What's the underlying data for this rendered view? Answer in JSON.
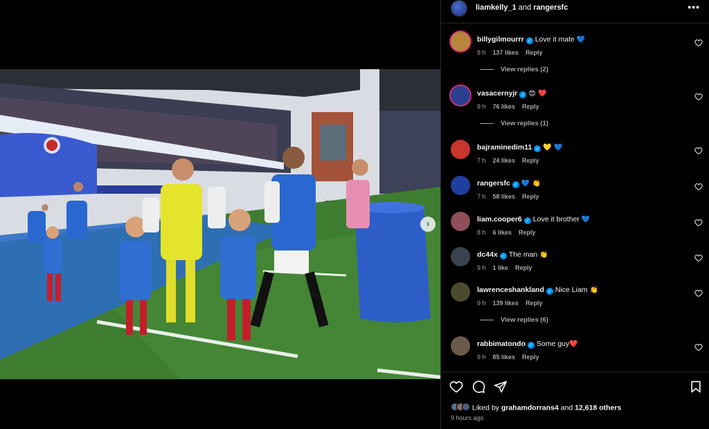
{
  "post": {
    "author": "liamkelly_1",
    "connector": "and",
    "collaborator": "rangersfc",
    "more_label": "•••"
  },
  "icons": {
    "verified": "verified-badge-icon",
    "heart": "heart-icon",
    "comment": "comment-icon",
    "share": "paper-plane-icon",
    "save": "bookmark-icon",
    "next": "chevron-right-icon"
  },
  "comments": [
    {
      "user": "billygilmourrr",
      "text": "Love it mate",
      "emoji": "💙",
      "time": "9 h",
      "likes": "137 likes",
      "reply": "Reply",
      "avatar_color": "#b8863b",
      "ring": true
    },
    {
      "user": "vasacernyjr",
      "text": "",
      "emoji": "😍 ❤️",
      "time": "9 h",
      "likes": "76 likes",
      "reply": "Reply",
      "avatar_color": "#2b3f8f",
      "ring": true
    },
    {
      "user": "bajraminedim11",
      "text": "",
      "emoji": "💛 💙",
      "time": "7 h",
      "likes": "24 likes",
      "reply": "Reply",
      "avatar_color": "#c8362d",
      "ring": false
    },
    {
      "user": "rangersfc",
      "text": "",
      "emoji": "💙 👏",
      "time": "7 h",
      "likes": "58 likes",
      "reply": "Reply",
      "avatar_color": "#1f3f9e",
      "ring": false
    },
    {
      "user": "liam.cooper6",
      "text": "Love it brother",
      "emoji": "💙",
      "time": "8 h",
      "likes": "6 likes",
      "reply": "Reply",
      "avatar_color": "#8e4f5a",
      "ring": false
    },
    {
      "user": "dc44x",
      "text": "The man",
      "emoji": "👏",
      "time": "9 h",
      "likes": "1 like",
      "reply": "Reply",
      "avatar_color": "#39434f",
      "ring": false
    },
    {
      "user": "lawrenceshankland",
      "text": "Nice Liam",
      "emoji": "👏",
      "time": "9 h",
      "likes": "139 likes",
      "reply": "Reply",
      "avatar_color": "#4a4a2c",
      "ring": false
    },
    {
      "user": "rabbimatondo",
      "text": "Some guy",
      "emoji": "❤️",
      "time": "9 h",
      "likes": "85 likes",
      "reply": "Reply",
      "avatar_color": "#6b5a4a",
      "ring": false
    }
  ],
  "view_replies": [
    "View replies (2)",
    "View replies (1)",
    "View replies (6)"
  ],
  "footer": {
    "liked_prefix": "Liked by",
    "liked_user": "grahamdorrans4",
    "liked_and": "and",
    "liked_others": "12,618 others",
    "time_ago": "9 hours ago"
  },
  "colors": {
    "background": "#000000",
    "verified": "#0095f6",
    "muted": "#a8a8a8",
    "rangers_blue": "#1f5fc4"
  }
}
